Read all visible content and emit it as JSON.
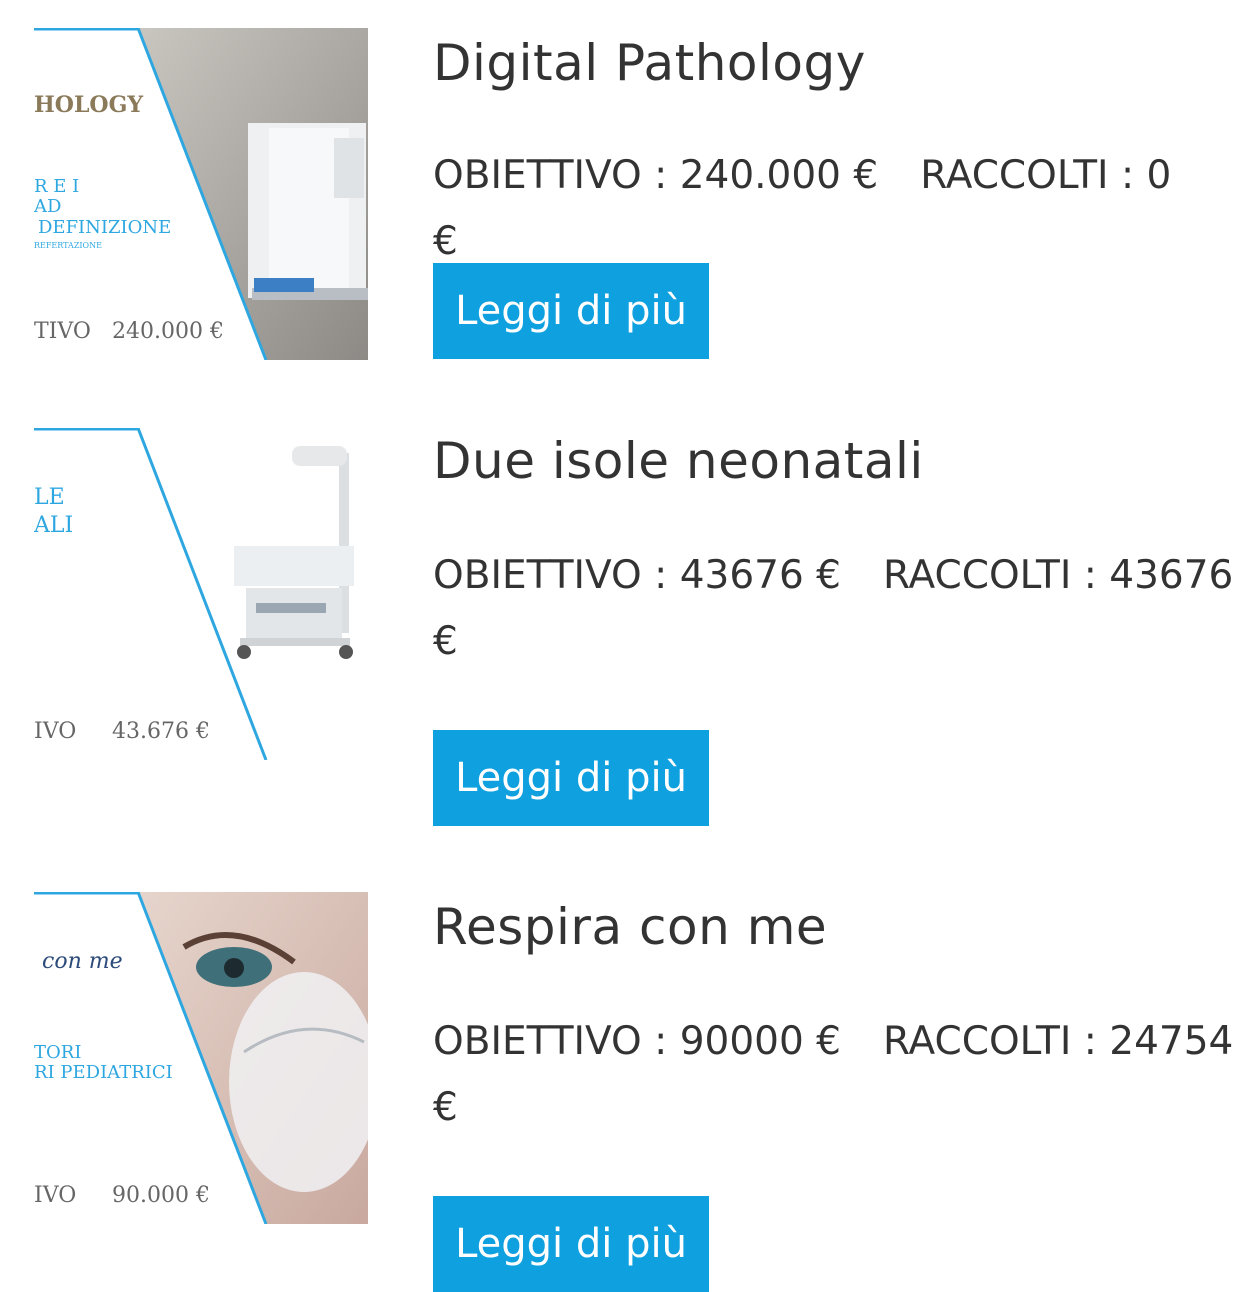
{
  "projects": [
    {
      "title": "Digital Pathology",
      "goal_label": "OBIETTIVO",
      "goal_value": "240.000 €",
      "raised_label": "RACCOLTI",
      "raised_value": "0 €",
      "button_label": "Leggi di più",
      "image": {
        "heading": "HOLOGY",
        "lines": [
          "R E I",
          "AD",
          "DEFINIZIONE",
          "REFERTAZIONE"
        ],
        "footer_label": "TIVO",
        "footer_value": "240.000 €"
      }
    },
    {
      "title": "Due isole neonatali",
      "goal_label": "OBIETTIVO",
      "goal_value": "43676 €",
      "raised_label": "RACCOLTI",
      "raised_value": "43676 €",
      "button_label": "Leggi di più",
      "image": {
        "heading": "",
        "lines": [
          "LE",
          "ALI"
        ],
        "footer_label": "IVO",
        "footer_value": "43.676 €"
      }
    },
    {
      "title": "Respira con me",
      "goal_label": "OBIETTIVO",
      "goal_value": "90000 €",
      "raised_label": "RACCOLTI",
      "raised_value": "24754 €",
      "button_label": "Leggi di più",
      "image": {
        "heading": "con me",
        "lines": [
          "TORI",
          "RI PEDIATRICI"
        ],
        "footer_label": "IVO",
        "footer_value": "90.000 €"
      }
    }
  ],
  "colors": {
    "accent": "#0fa0e0",
    "text": "#333333",
    "image_line": "#2ea7e0"
  }
}
